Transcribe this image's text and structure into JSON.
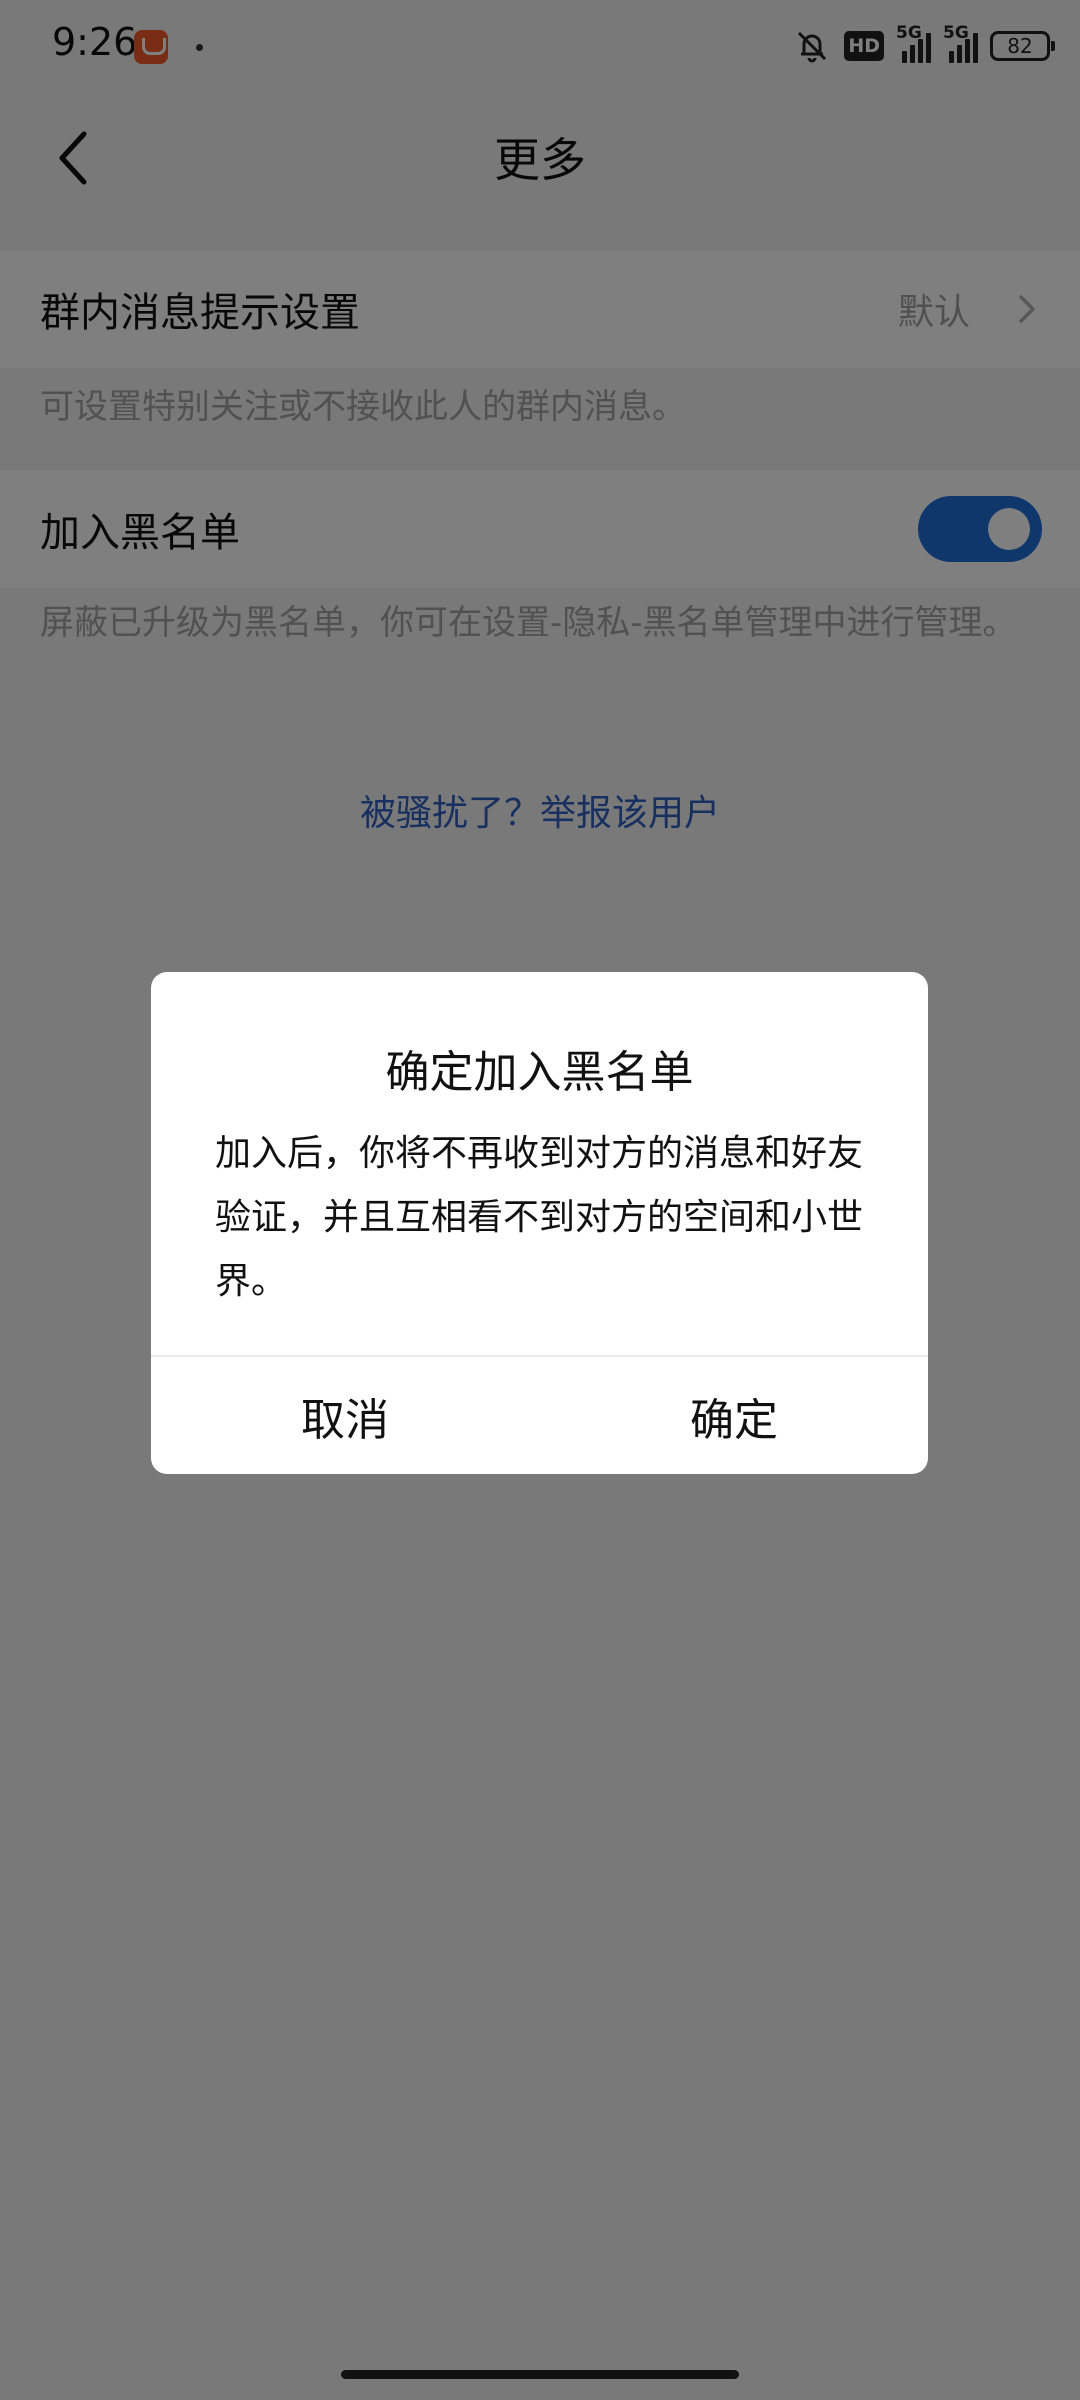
{
  "status_bar": {
    "time": "9:26",
    "app_icon": "qq-app-icon",
    "mute_icon": "bell-off-icon",
    "hd_label": "HD",
    "signal1_label": "5G",
    "signal2_label": "5G",
    "battery": "82"
  },
  "header": {
    "title": "更多",
    "back_icon": "chevron-left-icon"
  },
  "group_notify": {
    "label": "群内消息提示设置",
    "value": "默认",
    "hint": "可设置特别关注或不接收此人的群内消息。"
  },
  "blacklist": {
    "label": "加入黑名单",
    "toggle_on": true,
    "hint": "屏蔽已升级为黑名单，你可在设置-隐私-黑名单管理中进行管理。"
  },
  "report_link": "被骚扰了？举报该用户",
  "dialog": {
    "title": "确定加入黑名单",
    "message": "加入后，你将不再收到对方的消息和好友验证，并且互相看不到对方的空间和小世界。",
    "cancel_label": "取消",
    "confirm_label": "确定"
  },
  "colors": {
    "toggle_on": "#1e6ed6",
    "link": "#2f60bf",
    "overlay": "rgba(0,0,0,0.50)"
  }
}
